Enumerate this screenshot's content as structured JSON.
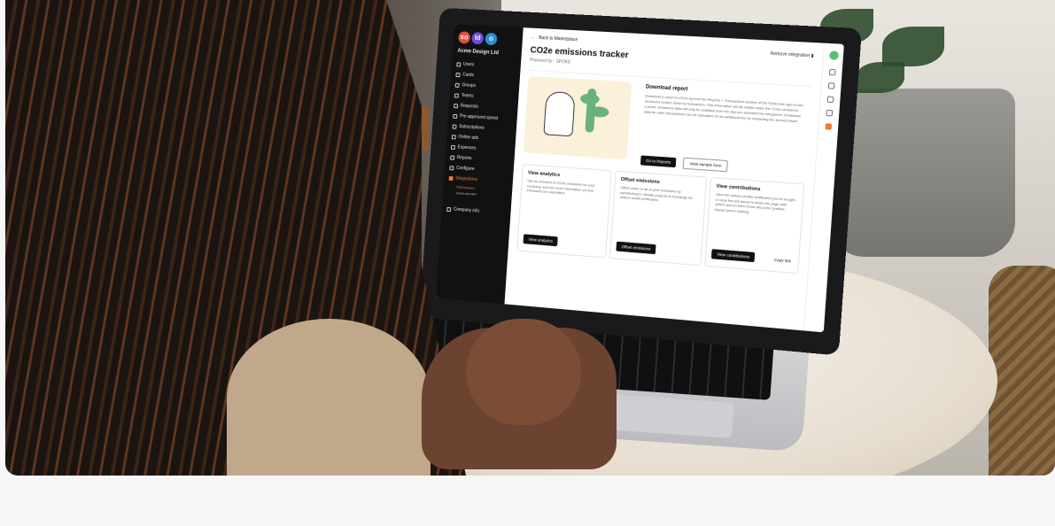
{
  "photo": {
    "alt_subject": "person-using-laptop-at-cafe-table"
  },
  "app": {
    "logo_letters": [
      "so",
      "ld",
      "o"
    ],
    "logo_colors": [
      "#e84b3c",
      "#6b4bdc",
      "#2a8fd8"
    ],
    "company": "Acme Design Ltd",
    "nav": [
      {
        "label": "Users",
        "icon": "users-icon"
      },
      {
        "label": "Cards",
        "icon": "cards-icon"
      },
      {
        "label": "Groups",
        "icon": "groups-icon"
      },
      {
        "label": "Teams",
        "icon": "teams-icon"
      },
      {
        "label": "Requests",
        "icon": "requests-icon"
      },
      {
        "label": "Pre-approved spend",
        "icon": "spend-icon"
      },
      {
        "label": "Subscriptions",
        "icon": "subscriptions-icon"
      },
      {
        "label": "Online ads",
        "icon": "ads-icon"
      },
      {
        "label": "Expenses",
        "icon": "expenses-icon"
      },
      {
        "label": "Reports",
        "icon": "reports-icon"
      },
      {
        "label": "Configure",
        "icon": "configure-icon"
      },
      {
        "label": "Integrations",
        "icon": "integrations-icon",
        "active": true
      }
    ],
    "sub_nav": [
      {
        "label": "Marketplace",
        "active": true
      },
      {
        "label": "Accounts API"
      }
    ],
    "company_info": "Company info",
    "back_link": "Back to Marketplace",
    "title": "CO2e emissions tracker",
    "powered_by": "Powered by · SPOKE",
    "remove": "Remove integration",
    "download": {
      "title": "Download report",
      "body": "Download a report in CO2e kg from the Reports > Transactions section of the Soldo web app to see emissions broken down by transaction. This information will be visible under the CO2e emissions column. Emissions data will only be available from the day you activated the integration. Emissions data for older transactions can be calculated for an additional fee by contacting the account team.",
      "primary": "Go to Reports",
      "secondary": "View sample form"
    },
    "tiles": [
      {
        "title": "View analytics",
        "body": "Get an overview of CO2e emissions for your company, and see more information on how emissions are calculated.",
        "button": "View analytics"
      },
      {
        "title": "Offset emissions",
        "body": "Offset some or all of your emissions by contributing to climate projects in exchange for carbon credit certificates.",
        "button": "Offset emissions"
      },
      {
        "title": "View contributions",
        "body": "View the carbon credits certificates you've bought, or copy the link below to share the page with others and let them know about the positive impact you're making.",
        "button": "View contributions",
        "copy": "Copy link"
      }
    ],
    "accent": "#f07c2d"
  }
}
